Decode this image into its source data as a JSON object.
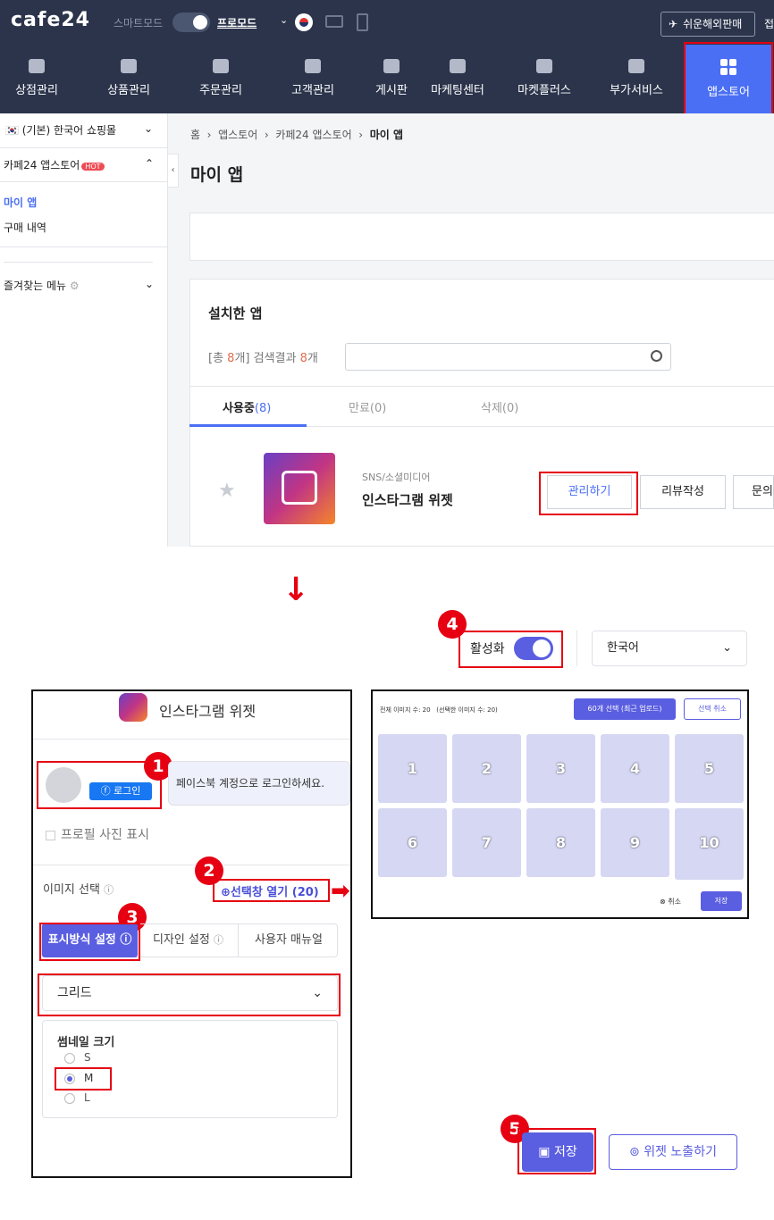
{
  "topbar": {
    "logo": "cafe24",
    "smart_mode": "스마트모드",
    "pro_mode": "프로모드",
    "global_button": "쉬운해외판매",
    "access": "접"
  },
  "nav": {
    "items": [
      {
        "label": "상점관리",
        "icon": "store-icon"
      },
      {
        "label": "상품관리",
        "icon": "shirt-icon"
      },
      {
        "label": "주문관리",
        "icon": "cart-icon"
      },
      {
        "label": "고객관리",
        "icon": "person-icon"
      },
      {
        "label": "게시판",
        "icon": "board-icon"
      },
      {
        "label": "마케팅센터",
        "icon": "megaphone-icon"
      },
      {
        "label": "마켓플러스",
        "icon": "share-icon"
      },
      {
        "label": "부가서비스",
        "icon": "folder-plus-icon"
      },
      {
        "label": "앱스토어",
        "icon": "grid-icon"
      }
    ]
  },
  "sidebar": {
    "mall": "(기본) 한국어 쇼핑몰",
    "section": "카페24 앱스토어",
    "hot": "HOT",
    "my_app": "마이 앱",
    "purchase": "구매 내역",
    "favorites": "즐겨찾는 메뉴"
  },
  "breadcrumb": {
    "home": "홈",
    "appstore": "앱스토어",
    "cafe24_appstore": "카페24 앱스토어",
    "current": "마이 앱"
  },
  "page": {
    "title": "마이 앱",
    "installed_title": "설치한 앱",
    "count_prefix": "[총 ",
    "count_total": "8",
    "count_mid": "개] 검색결과 ",
    "count_result": "8",
    "count_suffix": "개",
    "tabs": {
      "active_label": "사용중",
      "active_count": "(8)",
      "expired": "만료(0)",
      "deleted": "삭제(0)"
    },
    "app": {
      "category": "SNS/소셜미디어",
      "name": "인스타그램 위젯",
      "manage": "관리하기",
      "review": "리뷰작성",
      "inquiry": "문의"
    }
  },
  "activation": {
    "badge": "4",
    "label": "활성화",
    "enabled": true,
    "language": "한국어"
  },
  "widget": {
    "title": "인스타그램 위젯",
    "badge1": "1",
    "login": "로그인",
    "fb_message": "페이스북 계정으로 로그인하세요.",
    "profile": "프로필 사진 표시",
    "image_select": "이미지 선택",
    "badge2": "2",
    "open_picker": "선택창 열기 (20)",
    "badge3": "3",
    "tabs": [
      "표시방식 설정",
      "디자인 설정",
      "사용자 매뉴얼"
    ],
    "layout": "그리드",
    "thumb_title": "썸네일 크기",
    "sizes": [
      "S",
      "M",
      "L"
    ],
    "selected_size": "M"
  },
  "picker": {
    "total": "전체 이미지 수: 20",
    "selected": "(선택한 이미지 수: 20)",
    "select60": "60개 선택 (최근 업로드)",
    "deselect": "선택 취소",
    "tiles": [
      "1",
      "2",
      "3",
      "4",
      "5",
      "6",
      "7",
      "8",
      "9",
      "10"
    ],
    "cancel": "취소",
    "save": "저장"
  },
  "footer": {
    "badge5": "5",
    "save": "저장",
    "expose": "위젯 노출하기"
  },
  "colors": {
    "nav_bg": "#2b344b",
    "accent": "#4a6ff4",
    "purple": "#5a5ee0",
    "highlight": "#e60012"
  }
}
